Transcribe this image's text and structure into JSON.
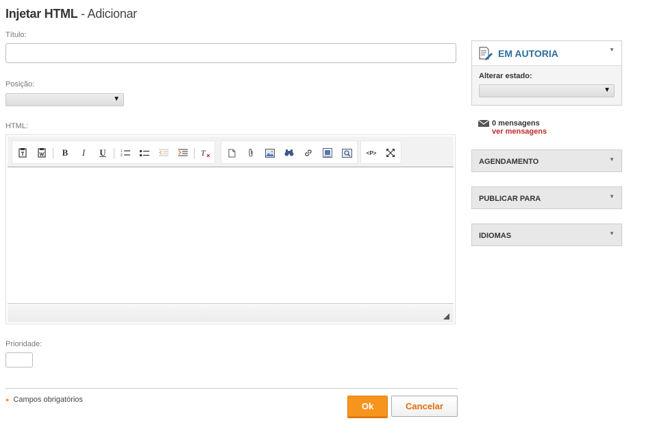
{
  "header": {
    "title_bold": "Injetar HTML",
    "title_rest": " - Adicionar"
  },
  "form": {
    "title_label": "Título:",
    "position_label": "Posição:",
    "html_label": "HTML:",
    "priority_label": "Prioridade:",
    "required_note": "Campos obrigatórios"
  },
  "editor": {
    "toolbar_icons": [
      "paste-text-icon",
      "paste-word-icon",
      "bold-icon",
      "italic-icon",
      "underline-icon",
      "numbered-list-icon",
      "bullet-list-icon",
      "outdent-icon",
      "indent-icon",
      "remove-format-icon",
      "new-page-icon",
      "attach-icon",
      "image-icon",
      "find-icon",
      "link-icon",
      "insert-media-icon",
      "preview-icon",
      "source-icon",
      "maximize-icon"
    ],
    "bold_glyph": "B",
    "italic_glyph": "I",
    "underline_glyph": "U",
    "source_glyph": "<P>"
  },
  "actions": {
    "ok_label": "Ok",
    "cancel_label": "Cancelar"
  },
  "sidebar": {
    "authorship_title": "EM AUTORIA",
    "state_label": "Alterar estado:",
    "messages_count": "0 mensagens",
    "messages_link": "ver mensagens",
    "panels": [
      {
        "title": "AGENDAMENTO"
      },
      {
        "title": "PUBLICAR PARA"
      },
      {
        "title": "IDIOMAS"
      }
    ]
  },
  "colors": {
    "accent": "#f7941d",
    "link": "#c0282d",
    "heading_blue": "#2a6d9e"
  }
}
